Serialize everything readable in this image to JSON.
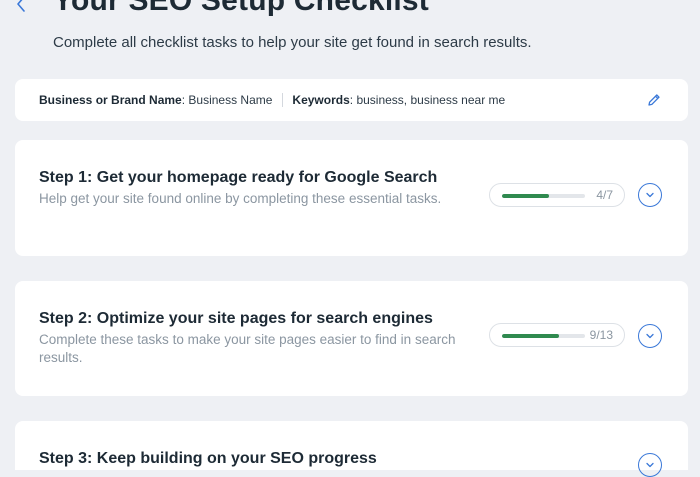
{
  "header": {
    "title": "Your SEO Setup Checklist",
    "subtitle": "Complete all checklist tasks to help your site get found in search results."
  },
  "info_bar": {
    "business_label": "Business or Brand Name",
    "business_value": ": Business Name",
    "keywords_label": "Keywords",
    "keywords_value": ": business, business near me"
  },
  "steps": [
    {
      "title": "Step 1: Get your homepage ready for Google Search",
      "description": "Help get your site found online by completing these essential tasks.",
      "progress_text": "4/7",
      "progress": 0.57
    },
    {
      "title": "Step 2: Optimize your site pages for search engines",
      "description": "Complete these tasks to make your site pages easier to find in search results.",
      "progress_text": "9/13",
      "progress": 0.69
    },
    {
      "title": "Step 3: Keep building on your SEO progress",
      "description": "",
      "progress_text": "",
      "progress": null
    }
  ],
  "icons": {
    "back": "chevron-left-icon",
    "edit": "pencil-icon",
    "expand": "chevron-down-icon"
  },
  "colors": {
    "accent": "#3a78d8",
    "progress": "#2f8a4f",
    "background": "#eef0f4"
  }
}
